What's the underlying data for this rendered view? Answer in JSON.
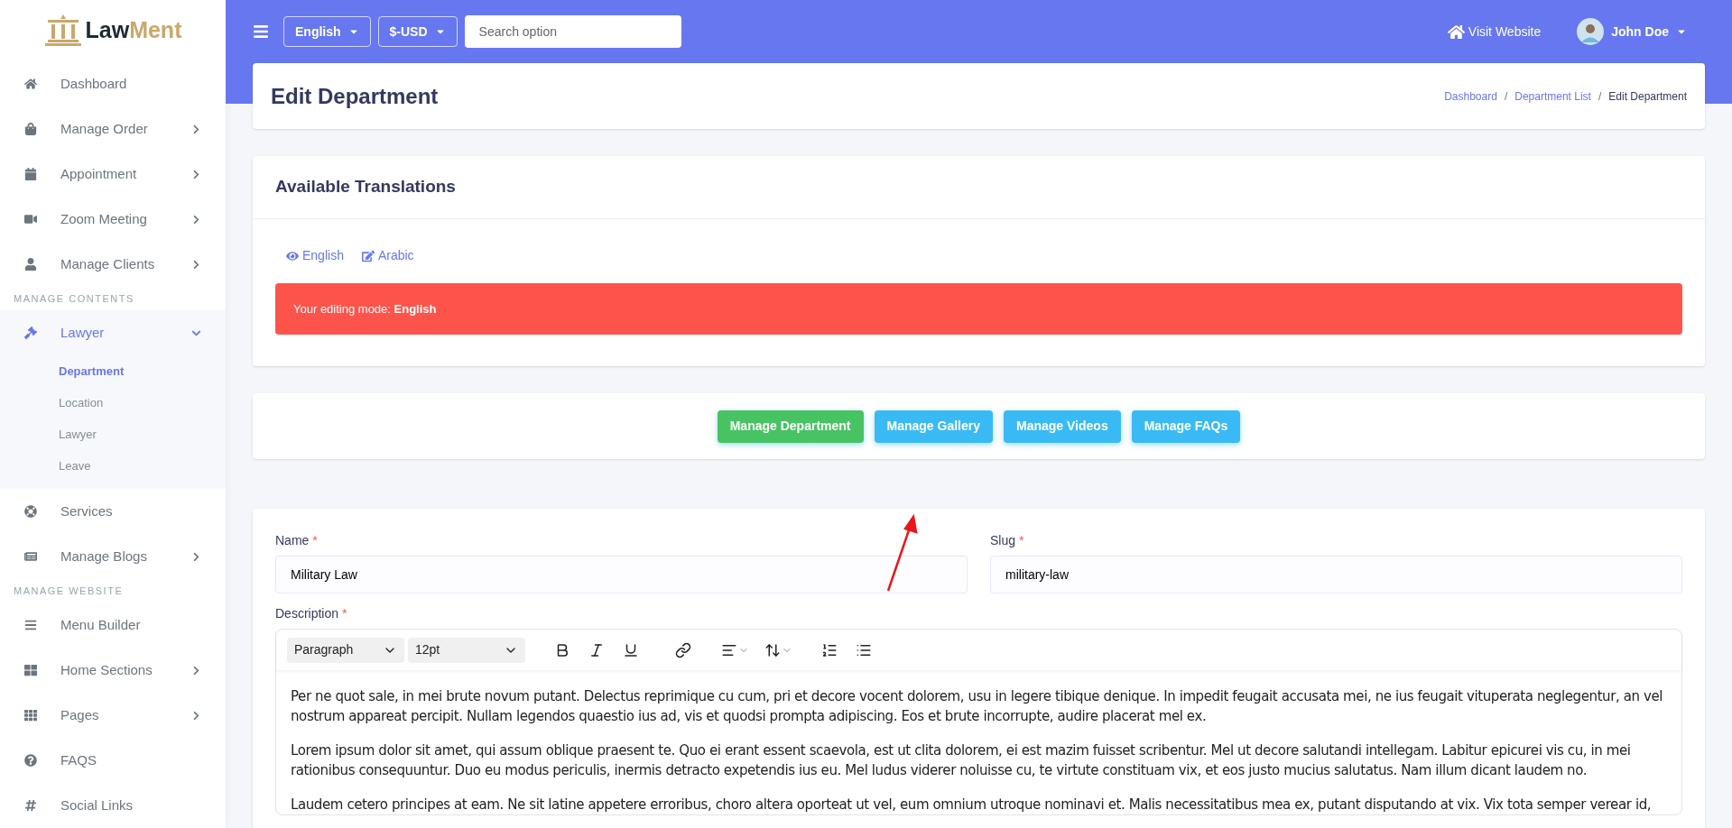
{
  "logo": {
    "part1": "Law",
    "part2": "Ment"
  },
  "sidebar": {
    "items": [
      {
        "kind": "item",
        "label": "Dashboard",
        "has_children": false,
        "selected": false
      },
      {
        "kind": "item",
        "label": "Manage Order",
        "has_children": true,
        "selected": false
      },
      {
        "kind": "item",
        "label": "Appointment",
        "has_children": true,
        "selected": false
      },
      {
        "kind": "item",
        "label": "Zoom Meeting",
        "has_children": true,
        "selected": false
      },
      {
        "kind": "item",
        "label": "Manage Clients",
        "has_children": true,
        "selected": false
      },
      {
        "kind": "section",
        "label": "MANAGE CONTENTS"
      },
      {
        "kind": "item",
        "label": "Lawyer",
        "has_children": true,
        "selected": true,
        "expanded": true,
        "children": [
          {
            "label": "Department",
            "selected": true
          },
          {
            "label": "Location",
            "selected": false
          },
          {
            "label": "Lawyer",
            "selected": false
          },
          {
            "label": "Leave",
            "selected": false
          }
        ]
      },
      {
        "kind": "item",
        "label": "Services",
        "has_children": false,
        "selected": false
      },
      {
        "kind": "item",
        "label": "Manage Blogs",
        "has_children": true,
        "selected": false
      },
      {
        "kind": "section",
        "label": "MANAGE WEBSITE"
      },
      {
        "kind": "item",
        "label": "Menu Builder",
        "has_children": false,
        "selected": false
      },
      {
        "kind": "item",
        "label": "Home Sections",
        "has_children": true,
        "selected": false
      },
      {
        "kind": "item",
        "label": "Pages",
        "has_children": true,
        "selected": false
      },
      {
        "kind": "item",
        "label": "FAQS",
        "has_children": false,
        "selected": false
      },
      {
        "kind": "item",
        "label": "Social Links",
        "has_children": false,
        "selected": false
      }
    ]
  },
  "topbar": {
    "language": "English",
    "currency": "$-USD",
    "search_placeholder": "Search option",
    "visit": "Visit Website",
    "user": "John Doe"
  },
  "header": {
    "title": "Edit Department",
    "separator": "/",
    "breadcrumb": [
      {
        "label": "Dashboard",
        "link": true
      },
      {
        "label": "Department List",
        "link": true
      },
      {
        "label": "Edit Department",
        "link": false
      }
    ]
  },
  "translations": {
    "title": "Available Translations",
    "languages": [
      {
        "label": "English"
      },
      {
        "label": "Arabic"
      }
    ],
    "alert": "Your editing mode: **English**"
  },
  "actions": [
    {
      "label": "Manage Department",
      "color": "#47c363"
    },
    {
      "label": "Manage Gallery",
      "color": "#3abaf4"
    },
    {
      "label": "Manage Videos",
      "color": "#3abaf4"
    },
    {
      "label": "Manage FAQs",
      "color": "#3abaf4"
    }
  ],
  "form": {
    "required_mark": "*",
    "name": {
      "label": "Name",
      "required": true,
      "value": "Military Law"
    },
    "slug": {
      "label": "Slug",
      "required": true,
      "value": "military-law"
    },
    "description": {
      "label": "Description",
      "required": true,
      "block": "Paragraph",
      "size": "12pt",
      "paragraphs": [
        "Per ne quot sale, in mei brute novum putant. Delectus reprimique cu cum, pri et decore vocent dolorem, usu in legere tibique denique. In impedit feugait accusata mei, ne ius feugait vituperata neglegentur, an vel nostrum appareat percipit. Nullam legendos quaestio ius ad, vis et quodsi prompta adipiscing. Eos et brute incorrupte, audire placerat mel ex.",
        "Lorem ipsum dolor sit amet, qui assum oblique praesent te. Quo ei erant essent scaevola, est ut clita dolorem, ei est mazim fuisset scribentur. Mel ut decore salutandi intellegam. Labitur epicurei vis cu, in mei rationibus consequuntur. Duo eu modus periculis, inermis detracto expetendis ius eu. Mel ludus viderer noluisse cu, te virtute constituam vix, et eos justo mucius salutatus. Nam illum dicant laudem no.",
        "Laudem cetero principes at eam. Ne sit latine appetere erroribus, choro altera oporteat ut vel, eum omnium utroque nominavi et. Malis necessitatibus mea ex, putant disputando at vix. Vix tota semper verear id,"
      ]
    }
  }
}
